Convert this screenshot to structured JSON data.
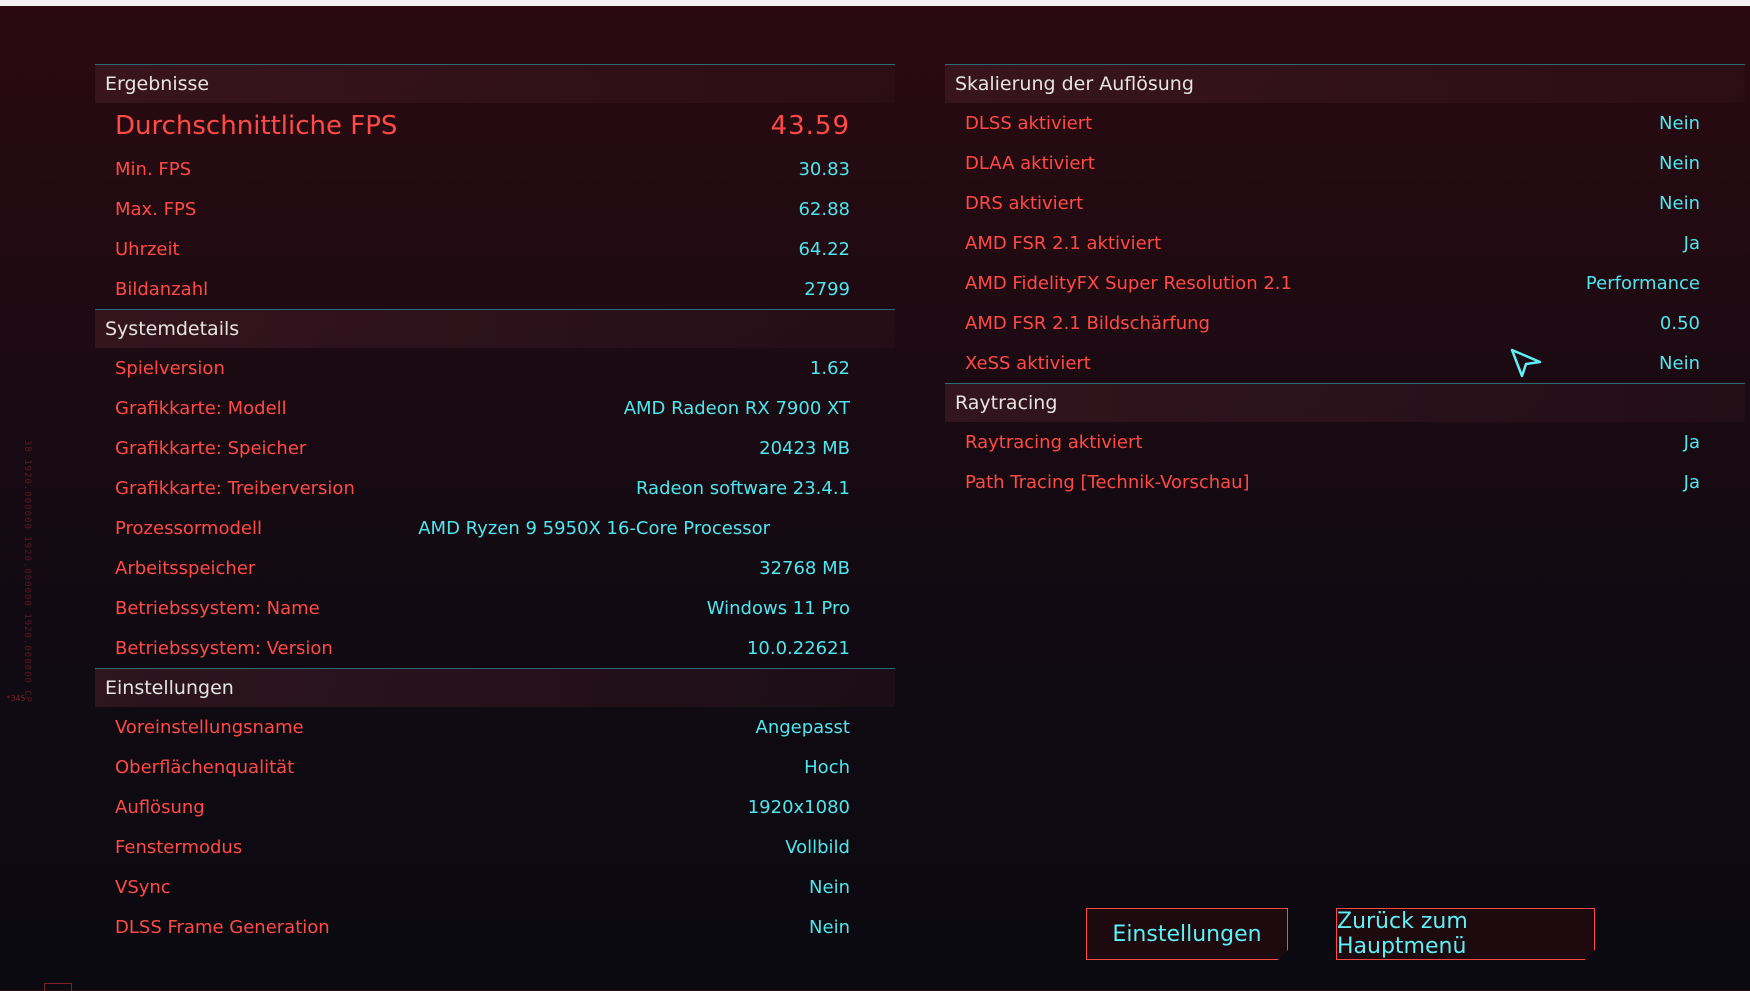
{
  "results": {
    "header": "Ergebnisse",
    "avg_fps": {
      "label": "Durchschnittliche FPS",
      "value": "43.59"
    },
    "rows": [
      {
        "label": "Min. FPS",
        "value": "30.83"
      },
      {
        "label": "Max. FPS",
        "value": "62.88"
      },
      {
        "label": "Uhrzeit",
        "value": "64.22"
      },
      {
        "label": "Bildanzahl",
        "value": "2799"
      }
    ]
  },
  "system": {
    "header": "Systemdetails",
    "rows": [
      {
        "label": "Spielversion",
        "value": "1.62"
      },
      {
        "label": "Grafikkarte: Modell",
        "value": "AMD Radeon RX 7900 XT"
      },
      {
        "label": "Grafikkarte: Speicher",
        "value": "20423 MB"
      },
      {
        "label": "Grafikkarte: Treiberversion",
        "value": "Radeon software 23.4.1"
      },
      {
        "label": "Prozessormodell",
        "value": "AMD Ryzen 9 5950X 16-Core Processor"
      },
      {
        "label": "Arbeitsspeicher",
        "value": "32768 MB"
      },
      {
        "label": "Betriebssystem: Name",
        "value": "Windows 11 Pro"
      },
      {
        "label": "Betriebssystem: Version",
        "value": "10.0.22621"
      }
    ]
  },
  "settings": {
    "header": "Einstellungen",
    "rows": [
      {
        "label": "Voreinstellungsname",
        "value": "Angepasst"
      },
      {
        "label": "Oberflächenqualität",
        "value": "Hoch"
      },
      {
        "label": "Auflösung",
        "value": "1920x1080"
      },
      {
        "label": "Fenstermodus",
        "value": "Vollbild"
      },
      {
        "label": "VSync",
        "value": "Nein"
      },
      {
        "label": "DLSS Frame Generation",
        "value": "Nein"
      }
    ]
  },
  "scaling": {
    "header": "Skalierung der Auflösung",
    "rows": [
      {
        "label": "DLSS aktiviert",
        "value": "Nein"
      },
      {
        "label": "DLAA aktiviert",
        "value": "Nein"
      },
      {
        "label": "DRS aktiviert",
        "value": "Nein"
      },
      {
        "label": "AMD FSR 2.1 aktiviert",
        "value": "Ja"
      },
      {
        "label": "AMD FidelityFX Super Resolution 2.1",
        "value": "Performance"
      },
      {
        "label": "AMD FSR 2.1 Bildschärfung",
        "value": "0.50"
      },
      {
        "label": "XeSS aktiviert",
        "value": "Nein"
      }
    ]
  },
  "raytracing": {
    "header": "Raytracing",
    "rows": [
      {
        "label": "Raytracing aktiviert",
        "value": "Ja"
      },
      {
        "label": "Path Tracing [Technik-Vorschau]",
        "value": "Ja"
      }
    ]
  },
  "buttons": {
    "settings": "Einstellungen",
    "back": "Zurück zum Hauptmenü"
  },
  "side_text": "38 1920.000000 1920.000000 1920.000000 CP",
  "side_mark": "*345"
}
